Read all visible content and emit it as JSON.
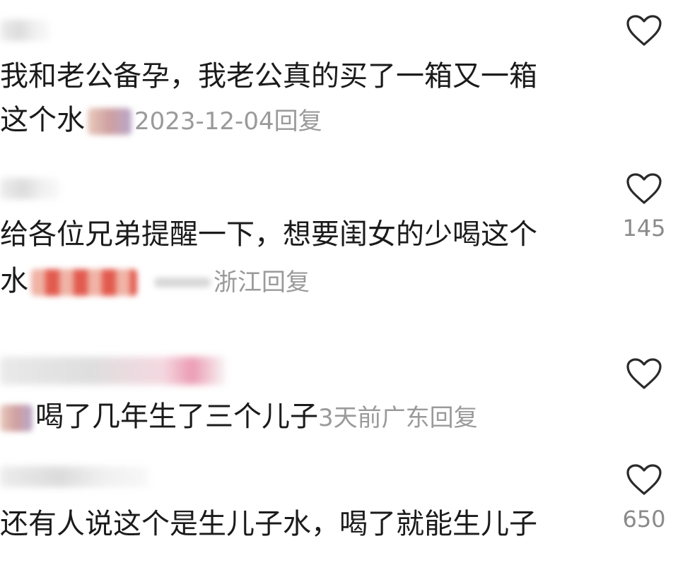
{
  "comments": [
    {
      "line1": "我和老公备孕，我老公真的买了一箱又一箱",
      "line2_prefix": "这个水",
      "date": "2023-12-04",
      "reply": "回复",
      "like_count": ""
    },
    {
      "line1": "给各位兄弟提醒一下，想要闺女的少喝这个",
      "line2_prefix": "水",
      "location": "浙江",
      "reply": "回复",
      "like_count": "145"
    },
    {
      "line1": "喝了几年生了三个儿子",
      "time": "3天前",
      "location": "广东",
      "reply": "回复",
      "like_count": ""
    },
    {
      "line1": "还有人说这个是生儿子水，喝了就能生儿子",
      "like_count": "650"
    }
  ],
  "icons": {
    "like": "heart-outline-icon"
  },
  "colors": {
    "text": "#1b1b1b",
    "meta": "#9a9a9a",
    "like_count": "#8a8a8a"
  }
}
